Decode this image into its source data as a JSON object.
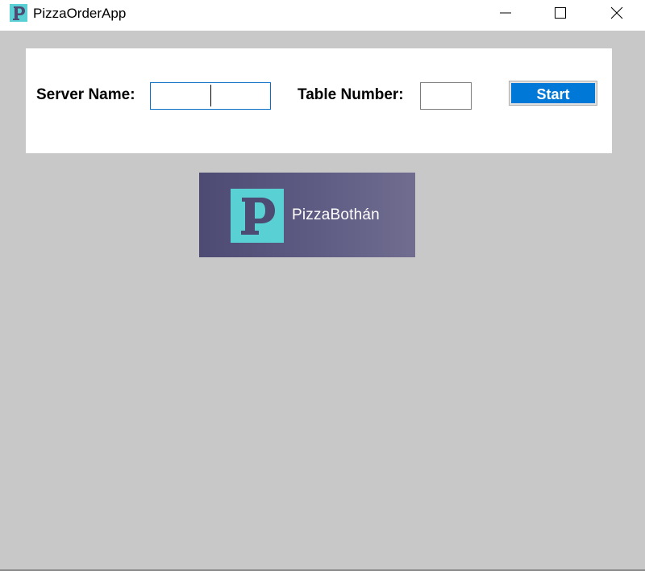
{
  "window": {
    "title": "PizzaOrderApp",
    "icon": "pizza-p-app-icon",
    "controls": [
      "minimize",
      "maximize",
      "close"
    ]
  },
  "form": {
    "server_label": "Server Name:",
    "server_value": "",
    "table_label": "Table Number:",
    "table_value": "",
    "start_label": "Start"
  },
  "logo": {
    "brand_text": "PizzaBothán",
    "icon": "pizza-p-logo"
  },
  "colors": {
    "background": "#c8c8c8",
    "accent_teal": "#59d0d3",
    "logo_bg": "#5f5c84",
    "button_blue": "#0078d7"
  }
}
